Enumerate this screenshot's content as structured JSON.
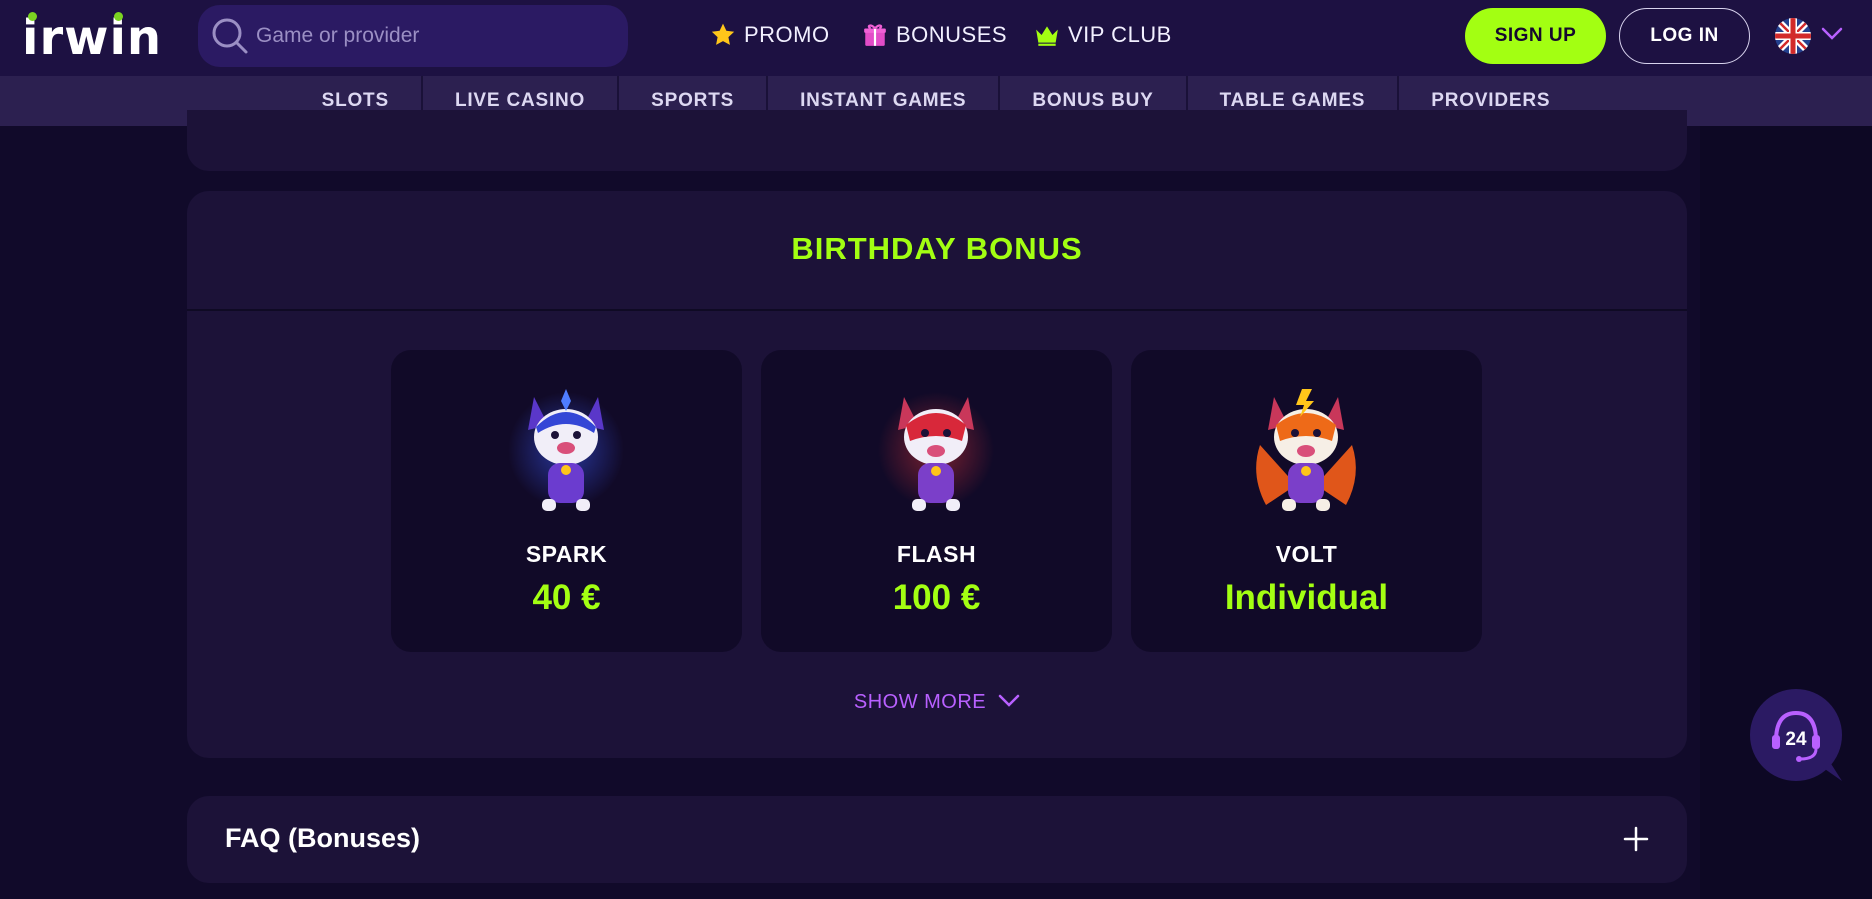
{
  "header": {
    "logo_text": "irwin",
    "search_placeholder": "Game or provider",
    "nav": [
      {
        "label": "PROMO",
        "icon": "star-icon"
      },
      {
        "label": "BONUSES",
        "icon": "gift-icon"
      },
      {
        "label": "VIP CLUB",
        "icon": "crown-icon"
      }
    ],
    "signup_label": "SIGN UP",
    "login_label": "LOG IN",
    "language_icon": "uk-flag-icon"
  },
  "categories": [
    "SLOTS",
    "LIVE CASINO",
    "SPORTS",
    "INSTANT GAMES",
    "BONUS BUY",
    "TABLE GAMES",
    "PROVIDERS"
  ],
  "birthday": {
    "title": "BIRTHDAY BONUS",
    "tiers": [
      {
        "name": "SPARK",
        "amount": "40 €",
        "color": "#3b3fd1"
      },
      {
        "name": "FLASH",
        "amount": "100 €",
        "color": "#d8283a"
      },
      {
        "name": "VOLT",
        "amount": "Individual",
        "color": "#ee6a18"
      }
    ],
    "show_more": "SHOW MORE"
  },
  "faq": {
    "label": "FAQ (Bonuses)"
  },
  "support": {
    "badge": "24"
  },
  "colors": {
    "accent_green": "#a3ff12",
    "accent_purple": "#b860ff",
    "bg": "#110a2a"
  }
}
